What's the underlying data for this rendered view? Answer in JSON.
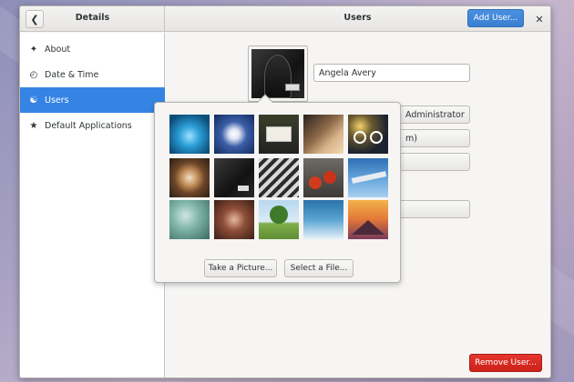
{
  "sidebar": {
    "title": "Details",
    "items": [
      {
        "label": "About",
        "icon": "star-sparkle-icon"
      },
      {
        "label": "Date & Time",
        "icon": "clock-icon"
      },
      {
        "label": "Users",
        "icon": "users-icon",
        "selected": true
      },
      {
        "label": "Default Applications",
        "icon": "star-icon"
      }
    ]
  },
  "header": {
    "title": "Users",
    "add_user_label": "Add User..."
  },
  "user": {
    "name": "Angela Avery",
    "account_type_visible": "Administrator",
    "partial_field_visible": "m)"
  },
  "picture_picker": {
    "take_picture_label": "Take a Picture...",
    "select_file_label": "Select a File..."
  },
  "remove_user_label": "Remove User...",
  "colors": {
    "accent": "#3584e4",
    "destructive": "#e01b24"
  }
}
